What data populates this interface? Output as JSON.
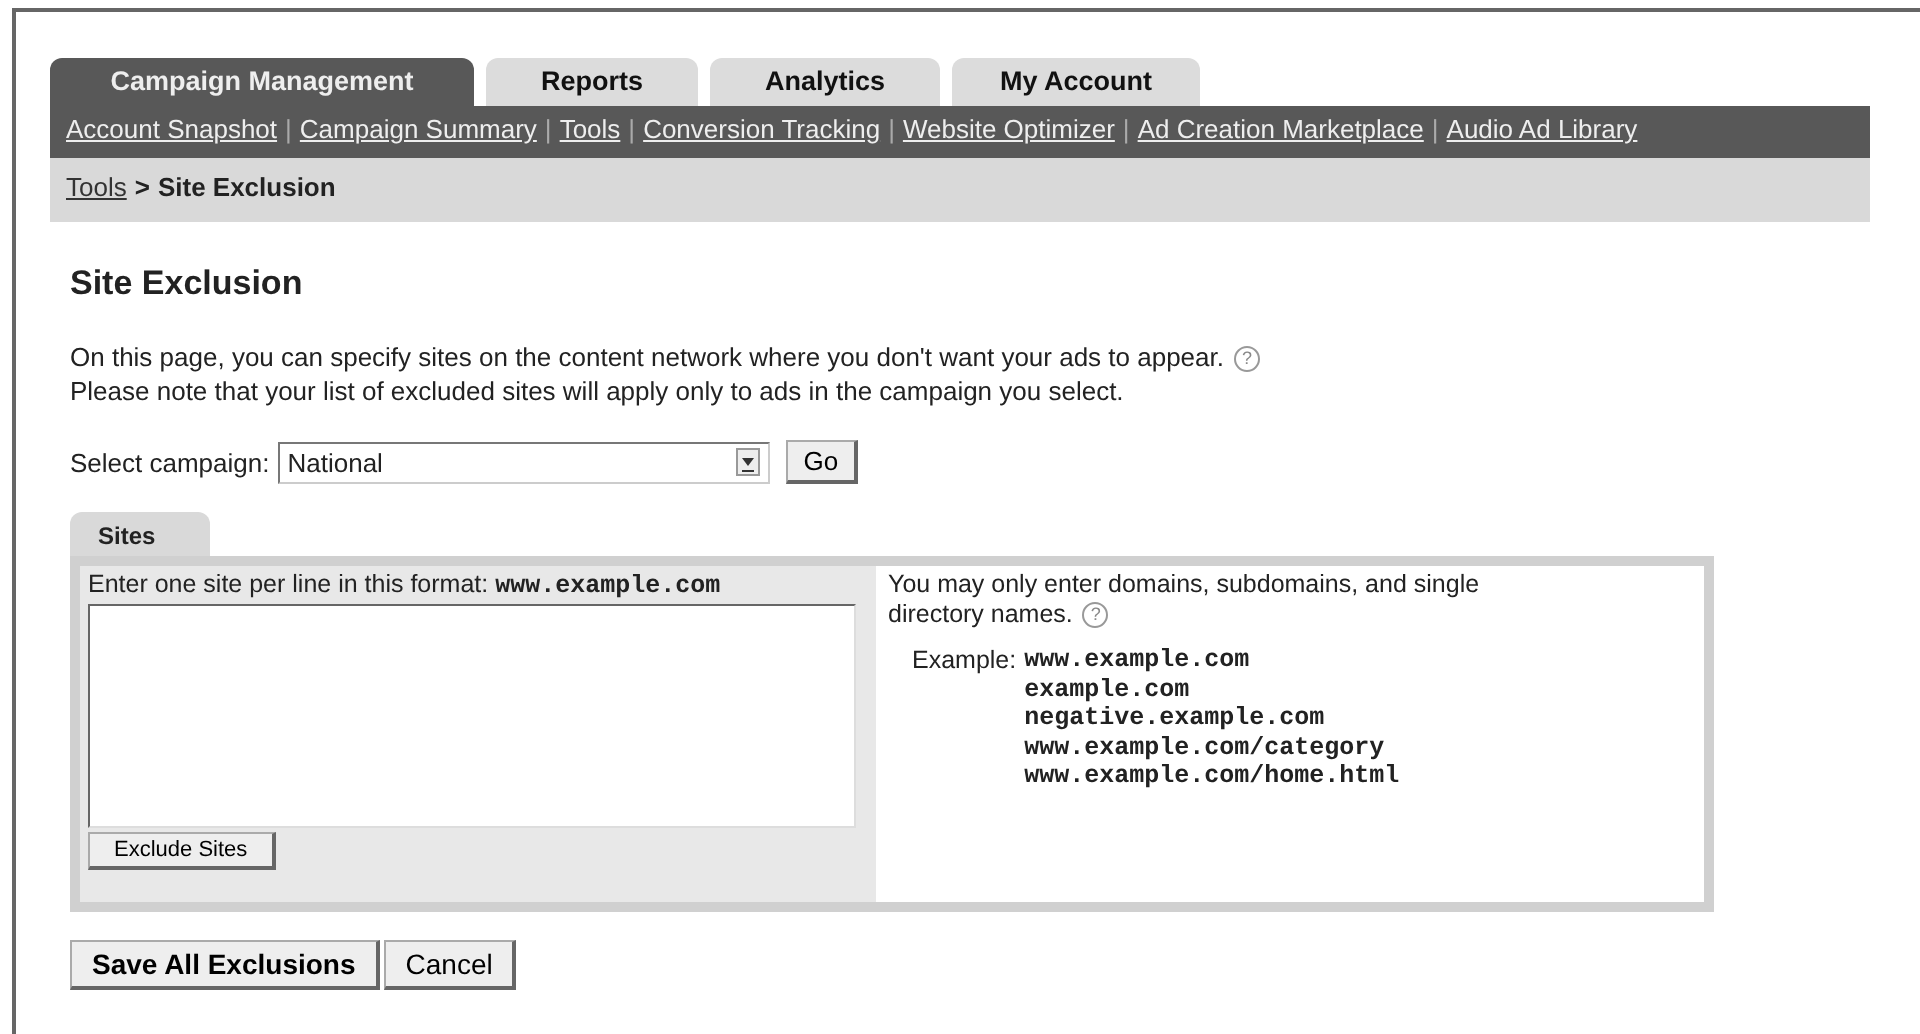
{
  "tabs": [
    {
      "label": "Campaign Management",
      "selected": true
    },
    {
      "label": "Reports",
      "selected": false
    },
    {
      "label": "Analytics",
      "selected": false
    },
    {
      "label": "My Account",
      "selected": false
    }
  ],
  "nav_links": [
    "Account Snapshot",
    "Campaign Summary",
    "Tools",
    "Conversion Tracking",
    "Website Optimizer",
    "Ad Creation Marketplace",
    "Audio Ad Library"
  ],
  "nav_separator": "|",
  "breadcrumb": {
    "link": "Tools",
    "separator": ">",
    "current": "Site Exclusion"
  },
  "heading": "Site Exclusion",
  "intro": {
    "line_1": "On this page, you can specify sites on the content network where you don't want your ads to appear.",
    "help": "?",
    "line_2": "Please note that your list of excluded sites will apply only to ads in the campaign you select."
  },
  "campaign": {
    "label": "Select campaign:",
    "value": "National",
    "go_button": "Go"
  },
  "sites_tab": {
    "label": "Sites",
    "selected": true
  },
  "entry": {
    "instruction": "Enter one site per line in this format:",
    "format": "www.example.com",
    "exclude_button": "Exclude Sites"
  },
  "note": {
    "line_1": "You may only enter domains, subdomains, and single",
    "line_2": "directory names.",
    "help": "?",
    "example_label": "Example:",
    "examples": [
      "www.example.com",
      "example.com",
      "negative.example.com",
      "www.example.com/category",
      "www.example.com/home.html"
    ]
  },
  "buttons": [
    "Save All Exclusions",
    "Cancel"
  ]
}
